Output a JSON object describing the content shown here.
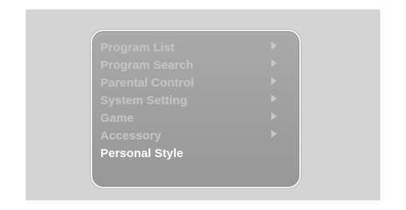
{
  "menu": {
    "items": [
      {
        "label": "Program List",
        "icon": "chevron-right-icon",
        "active": false
      },
      {
        "label": "Program Search",
        "icon": "chevron-right-icon",
        "active": false
      },
      {
        "label": "Parental Control",
        "icon": "chevron-right-icon",
        "active": false
      },
      {
        "label": "System Setting",
        "icon": "chevron-right-icon",
        "active": false
      },
      {
        "label": "Game",
        "icon": "chevron-right-icon",
        "active": false
      },
      {
        "label": "Accessory",
        "icon": "chevron-right-icon",
        "active": false
      },
      {
        "label": "Personal Style",
        "active": true
      }
    ]
  },
  "colors": {
    "screen_background": "#d4d4d4",
    "menu_panel": "#a3a3a3",
    "menu_border": "#f1f1f1",
    "inactive_text": "#c4c4c4",
    "active_text": "#ffffff",
    "arrow": "#c7c7c7"
  }
}
